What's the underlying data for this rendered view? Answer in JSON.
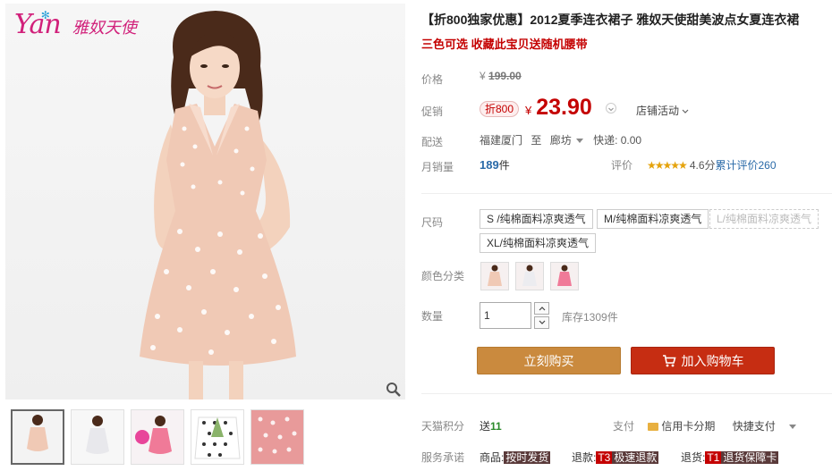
{
  "gallery": {
    "logo_text": "Yan",
    "logo_cn": "雅奴天使",
    "zoom_icon": "magnifier-icon",
    "thumbs": [
      "thumb-1",
      "thumb-2",
      "thumb-3",
      "thumb-4",
      "thumb-5"
    ]
  },
  "product": {
    "title": "【折800独家优惠】2012夏季连衣裙子 雅奴天使甜美波点女夏连衣裙",
    "subtitle": "三色可选 收藏此宝贝送随机腰带"
  },
  "price": {
    "label": "价格",
    "currency": "¥",
    "original": "199.00",
    "promo_label": "促销",
    "badge": "折800",
    "current": "23.90",
    "store_promo": "店铺活动"
  },
  "shipping": {
    "label": "配送",
    "from": "福建厦门",
    "to_word": "至",
    "dest": "廊坊",
    "fee": "快递: 0.00"
  },
  "sales": {
    "label": "月销量",
    "count": "189",
    "unit": "件",
    "review_label": "评价",
    "stars": "★★★★★",
    "score": "4.6分",
    "review_count_text": "累计评价260"
  },
  "sizes": {
    "label": "尺码",
    "options": [
      "S /纯棉面料凉爽透气",
      "M/纯棉面料凉爽透气",
      "L/纯棉面料凉爽透气",
      "XL/纯棉面料凉爽透气"
    ]
  },
  "colors": {
    "label": "颜色分类"
  },
  "quantity": {
    "label": "数量",
    "value": "1",
    "stock": "库存1309件"
  },
  "actions": {
    "buy_now": "立刻购买",
    "add_cart": "加入购物车"
  },
  "points": {
    "label": "天猫积分",
    "value_prefix": "送",
    "value": "11"
  },
  "payment": {
    "label": "支付",
    "card": "信用卡分期",
    "fast": "快捷支付"
  },
  "service": {
    "label": "服务承诺",
    "items": [
      {
        "prefix": "商品:",
        "tag": "按时发货"
      },
      {
        "prefix": "退款:",
        "tag_code": "T3",
        "tag": "极速退款"
      },
      {
        "prefix": "退货:",
        "tag_code": "T1",
        "tag": "退货保障卡"
      }
    ]
  },
  "colors_theme": {
    "accent_red": "#c40000",
    "buy_orange": "#ca8a3e",
    "cart_red": "#c62d12",
    "dress_pink": "#f0c9b5"
  }
}
